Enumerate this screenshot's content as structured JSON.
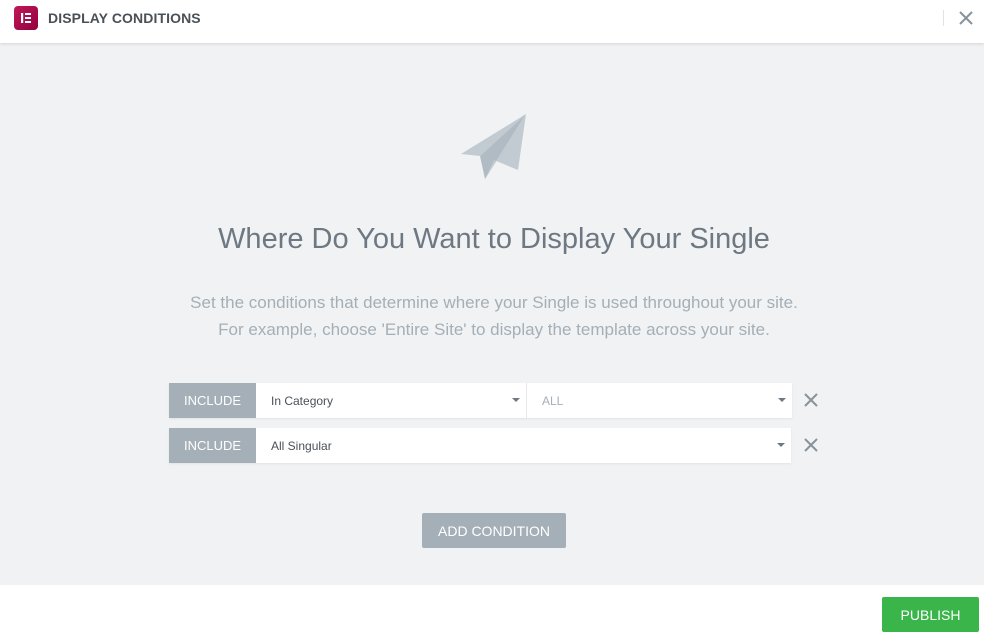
{
  "header": {
    "title": "DISPLAY CONDITIONS",
    "logo_icon": "elementor-logo-icon",
    "close_icon": "close-icon"
  },
  "main": {
    "title": "Where Do You Want to Display Your Single",
    "description_line1": "Set the conditions that determine where your Single is used throughout your site.",
    "description_line2": "For example, choose 'Entire Site' to display the template across your site.",
    "illustration_icon": "paper-plane-icon",
    "conditions": [
      {
        "type_label": "INCLUDE",
        "selection": "In Category",
        "sub_selection": "ALL"
      },
      {
        "type_label": "INCLUDE",
        "selection": "All Singular"
      }
    ],
    "add_condition_label": "ADD CONDITION"
  },
  "footer": {
    "publish_label": "PUBLISH"
  },
  "colors": {
    "accent_green": "#39b54a",
    "neutral_button": "#a4afb7",
    "brand": "#92003b",
    "background": "#f1f2f3"
  }
}
